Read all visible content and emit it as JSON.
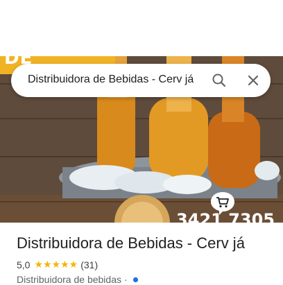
{
  "search": {
    "query": "Distribuidora de Bebidas - Cerv já",
    "search_icon": "search-icon",
    "close_icon": "close-icon"
  },
  "hero": {
    "banner_text": "DE BEBIDAS",
    "phone_text": "3421 7305"
  },
  "place": {
    "title": "Distribuidora de Bebidas - Cerv já",
    "rating": "5,0",
    "stars": "★★★★★",
    "review_count": "(31)",
    "category": "Distribuidora de bebidas ·"
  },
  "colors": {
    "star": "#f4b400",
    "accent_blue": "#1a73e8",
    "banner_yellow": "#f0b323"
  }
}
